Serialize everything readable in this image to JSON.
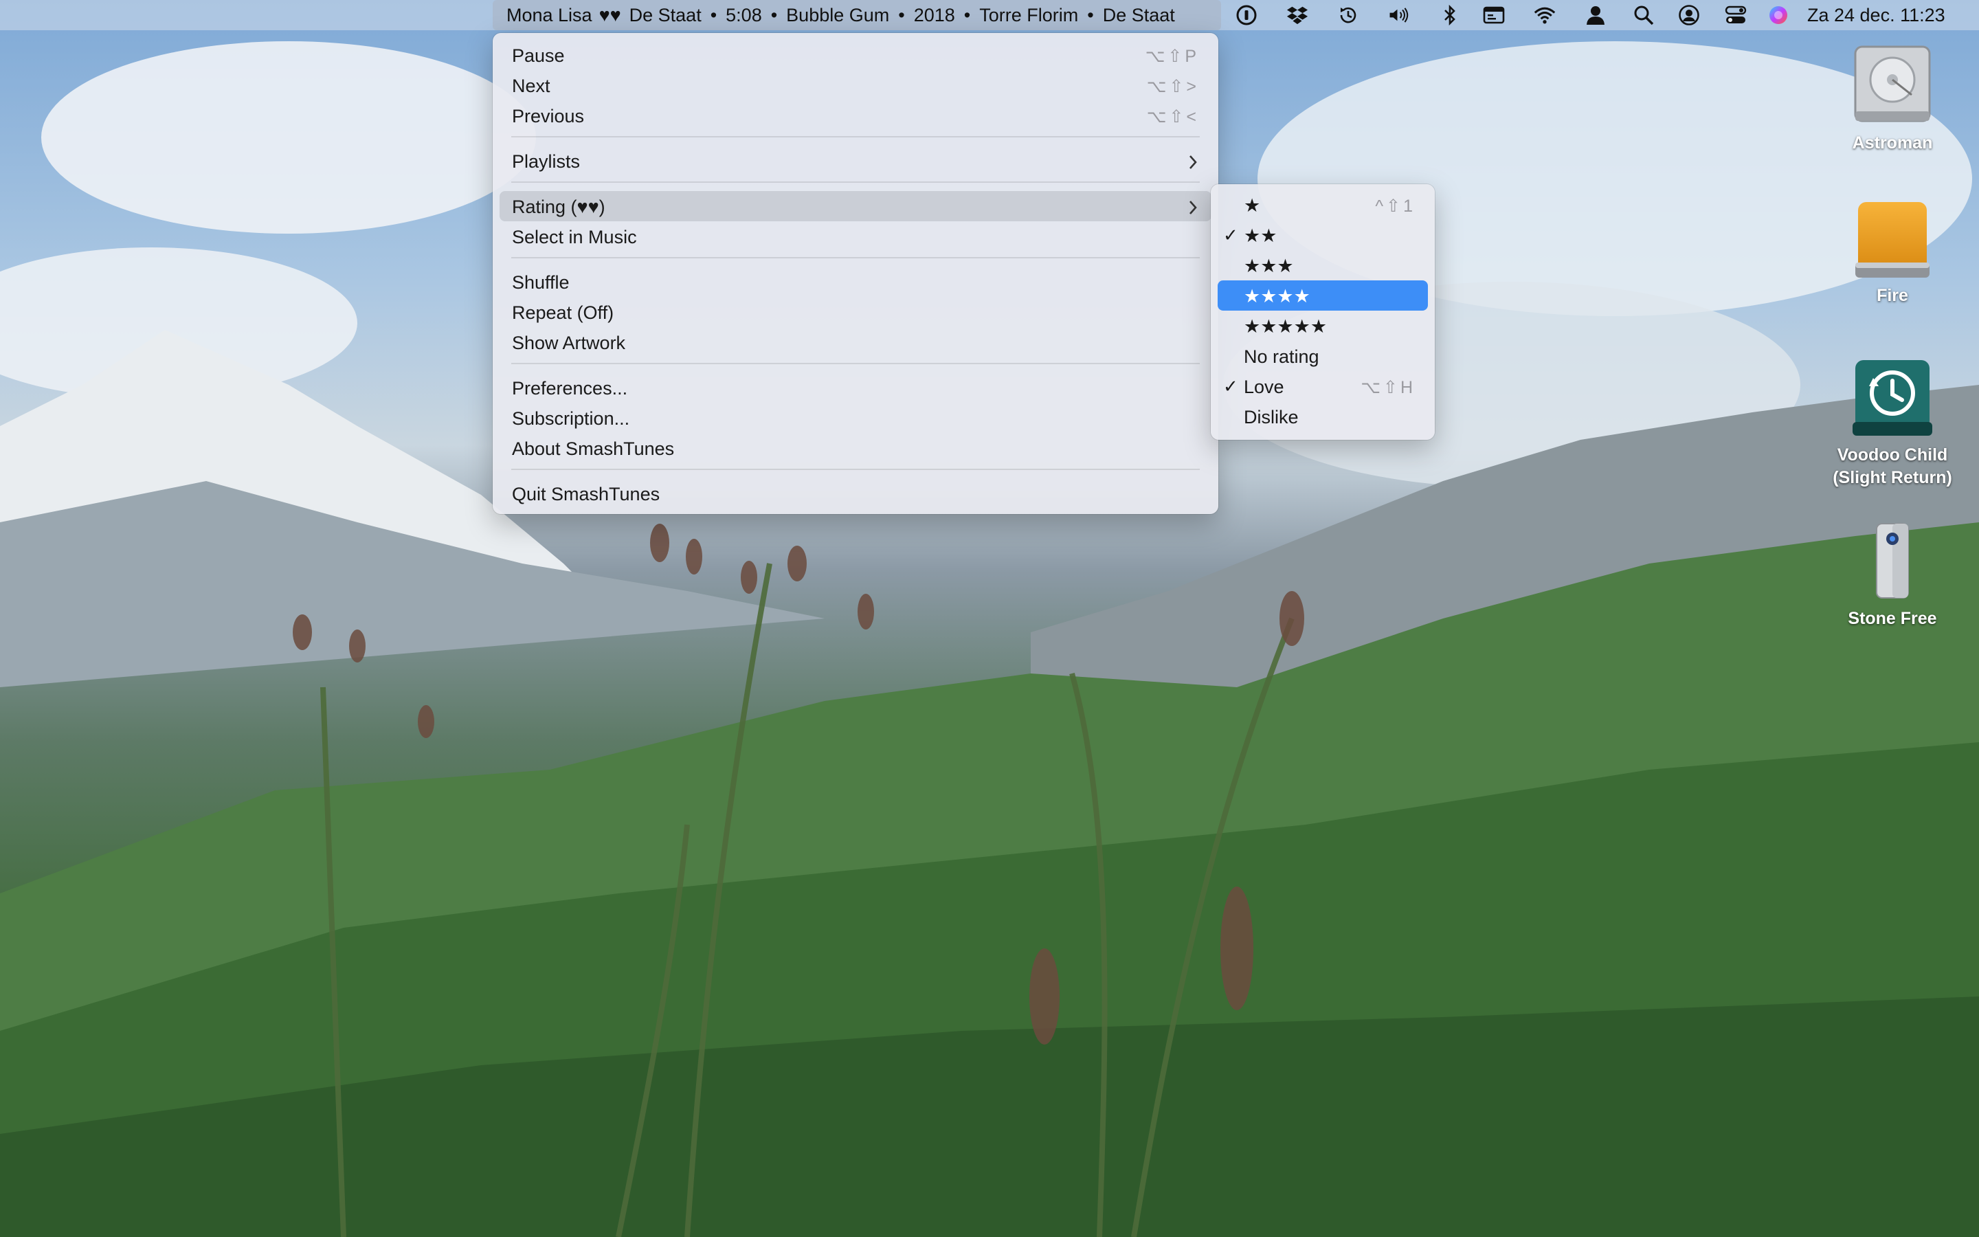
{
  "menubar": {
    "now_playing": {
      "song": "Mona Lisa",
      "hearts": "♥♥",
      "artist": "De Staat",
      "duration": "5:08",
      "album": "Bubble Gum",
      "year": "2018",
      "album_track": "Torre Florim",
      "album_artist": "De Staat",
      "separator": "•"
    },
    "status_icons": [
      "password-icon",
      "dropbox-icon",
      "time-machine-icon",
      "volume-icon",
      "bluetooth-icon",
      "display-icon",
      "wifi-icon",
      "user-icon",
      "spotlight-search-icon",
      "user-account-icon",
      "control-center-icon",
      "siri-icon"
    ],
    "clock": "Za 24 dec.  11:23"
  },
  "main_menu": {
    "items": [
      {
        "label": "Pause",
        "shortcut": "⌥⇧P"
      },
      {
        "label": "Next",
        "shortcut": "⌥⇧>"
      },
      {
        "label": "Previous",
        "shortcut": "⌥⇧<"
      },
      {
        "label": "Playlists"
      },
      {
        "label": "Rating (♥♥)"
      },
      {
        "label": "Select in Music"
      },
      {
        "label": "Shuffle"
      },
      {
        "label": "Repeat (Off)"
      },
      {
        "label": "Show Artwork"
      },
      {
        "label": "Preferences..."
      },
      {
        "label": "Subscription..."
      },
      {
        "label": "About SmashTunes"
      },
      {
        "label": "Quit SmashTunes"
      }
    ]
  },
  "rating_submenu": {
    "check_mark": "✓",
    "items": [
      {
        "label": "★",
        "shortcut": "^⇧1",
        "checked": false
      },
      {
        "label": "★★",
        "checked": true
      },
      {
        "label": "★★★",
        "checked": false
      },
      {
        "label": "★★★★",
        "checked": false,
        "selected": true
      },
      {
        "label": "★★★★★",
        "checked": false
      },
      {
        "label": "No rating",
        "checked": false
      },
      {
        "label": "Love",
        "shortcut": "⌥⇧H",
        "checked": true
      },
      {
        "label": "Dislike",
        "checked": false
      }
    ]
  },
  "desktop": {
    "items": [
      {
        "label": "Astroman",
        "icon": "hard-disk-icon"
      },
      {
        "label": "Fire",
        "icon": "external-drive-icon"
      },
      {
        "label_line1": "Voodoo Child",
        "label_line2": "(Slight Return)",
        "icon": "time-machine-drive-icon"
      },
      {
        "label": "Stone Free",
        "icon": "usb-drive-icon"
      }
    ]
  },
  "colors": {
    "selection": "#3d8ef7",
    "menu_background": "#e8eaf0",
    "menubar_highlight": "#aab9cd"
  }
}
